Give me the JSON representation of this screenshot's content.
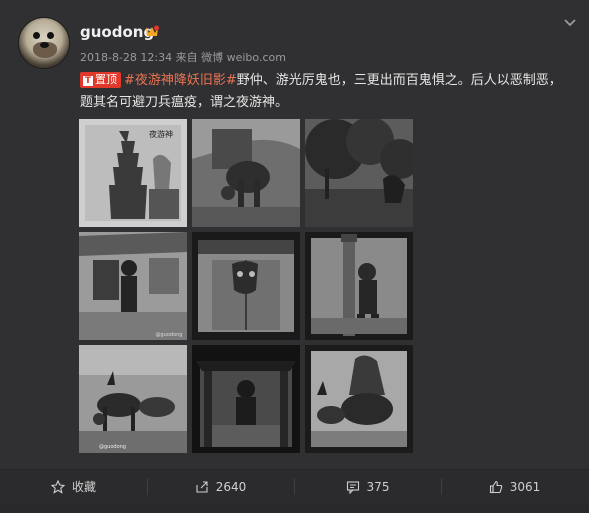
{
  "post": {
    "username": "guodong",
    "meta": "2018-8-28 12:34 来自 微博 weibo.com",
    "badge_label": "置顶",
    "hashtag": "#夜游神降妖旧影#",
    "body": "野仲、游光厉鬼也，三更出而百鬼惧之。后人以恶制恶，题其名可避刀兵瘟疫，谓之夜游神。",
    "photos": [
      {
        "caption": "夜游神"
      },
      {
        "caption": ""
      },
      {
        "caption": ""
      },
      {
        "caption": "@guodong"
      },
      {
        "caption": ""
      },
      {
        "caption": ""
      },
      {
        "caption": "@guodong"
      },
      {
        "caption": ""
      },
      {
        "caption": ""
      }
    ]
  },
  "actions": {
    "favorite": {
      "label": "收藏",
      "icon": "star-icon"
    },
    "repost": {
      "count": "2640",
      "icon": "repost-icon"
    },
    "comment": {
      "count": "375",
      "icon": "comment-icon"
    },
    "like": {
      "count": "3061",
      "icon": "thumbs-up-icon"
    }
  },
  "colors": {
    "background": "#303033",
    "accent": "#eb7350",
    "badge": "#e0392b"
  }
}
